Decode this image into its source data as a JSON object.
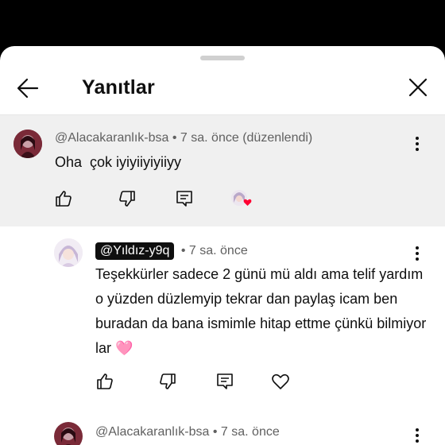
{
  "header": {
    "title": "Yanıtlar",
    "back_icon": "arrow-left-icon",
    "close_icon": "close-icon"
  },
  "parent_comment": {
    "author": "@Alacakaranlık-bsa",
    "meta": "• 7 sa. önce (düzenlendi)",
    "text": "Oha  çok iyiyiiyiyiiyy",
    "actions": [
      "thumbs-up-icon",
      "thumbs-down-icon",
      "reply-icon",
      "creator-heart-icon"
    ]
  },
  "reply": {
    "author": "@Yıldız-y9q",
    "meta": "• 7 sa. önce",
    "text": "Teşekkürler sadece 2 günü mü aldı ama telif yardım o yüzden düzlemyip tekrar dan paylaş icam ben buradan da bana ismimle hitap ettme çünkü bilmiyor lar 🩷",
    "actions": [
      "thumbs-up-icon",
      "thumbs-down-icon",
      "reply-icon",
      "heart-outline-icon"
    ]
  },
  "next_comment": {
    "author": "@Alacakaranlık-bsa",
    "meta": "• 7 sa. önce"
  },
  "colors": {
    "highlight_bg": "#f0f0f0",
    "text_primary": "#0f0f0f",
    "text_secondary": "#606060",
    "heart": "#ff0033",
    "chip_bg": "#0f0f0f"
  }
}
